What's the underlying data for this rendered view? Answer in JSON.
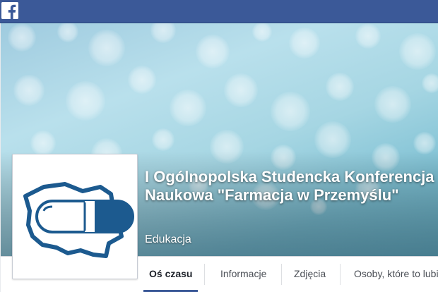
{
  "topbar": {
    "logo_icon": "facebook-f-icon",
    "color": "#3b5998"
  },
  "page": {
    "name": "I Ogólnopolska Studencka Konferencja Naukowa \"Farmacja w Przemyślu\"",
    "category": "Edukacja",
    "profile_icon": "poland-map-capsule-logo",
    "logo_color": "#1c5a8f"
  },
  "tabs": [
    {
      "label": "Oś czasu",
      "active": true
    },
    {
      "label": "Informacje",
      "active": false
    },
    {
      "label": "Zdjęcia",
      "active": false
    },
    {
      "label": "Osoby, które to lubią",
      "active": false
    }
  ]
}
